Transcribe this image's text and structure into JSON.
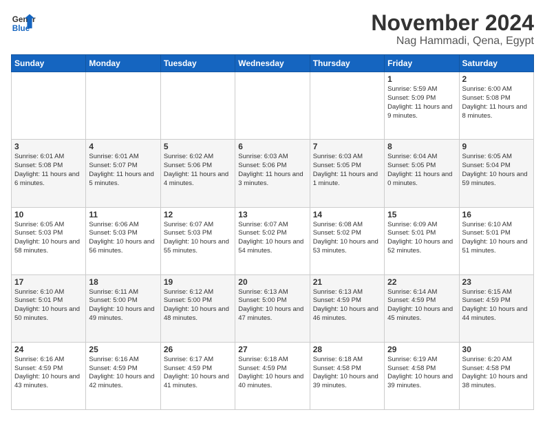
{
  "logo": {
    "line1": "General",
    "line2": "Blue"
  },
  "title": "November 2024",
  "subtitle": "Nag Hammadi, Qena, Egypt",
  "days_header": [
    "Sunday",
    "Monday",
    "Tuesday",
    "Wednesday",
    "Thursday",
    "Friday",
    "Saturday"
  ],
  "weeks": [
    [
      {
        "day": "",
        "info": ""
      },
      {
        "day": "",
        "info": ""
      },
      {
        "day": "",
        "info": ""
      },
      {
        "day": "",
        "info": ""
      },
      {
        "day": "",
        "info": ""
      },
      {
        "day": "1",
        "info": "Sunrise: 5:59 AM\nSunset: 5:09 PM\nDaylight: 11 hours\nand 9 minutes."
      },
      {
        "day": "2",
        "info": "Sunrise: 6:00 AM\nSunset: 5:08 PM\nDaylight: 11 hours\nand 8 minutes."
      }
    ],
    [
      {
        "day": "3",
        "info": "Sunrise: 6:01 AM\nSunset: 5:08 PM\nDaylight: 11 hours\nand 6 minutes."
      },
      {
        "day": "4",
        "info": "Sunrise: 6:01 AM\nSunset: 5:07 PM\nDaylight: 11 hours\nand 5 minutes."
      },
      {
        "day": "5",
        "info": "Sunrise: 6:02 AM\nSunset: 5:06 PM\nDaylight: 11 hours\nand 4 minutes."
      },
      {
        "day": "6",
        "info": "Sunrise: 6:03 AM\nSunset: 5:06 PM\nDaylight: 11 hours\nand 3 minutes."
      },
      {
        "day": "7",
        "info": "Sunrise: 6:03 AM\nSunset: 5:05 PM\nDaylight: 11 hours\nand 1 minute."
      },
      {
        "day": "8",
        "info": "Sunrise: 6:04 AM\nSunset: 5:05 PM\nDaylight: 11 hours\nand 0 minutes."
      },
      {
        "day": "9",
        "info": "Sunrise: 6:05 AM\nSunset: 5:04 PM\nDaylight: 10 hours\nand 59 minutes."
      }
    ],
    [
      {
        "day": "10",
        "info": "Sunrise: 6:05 AM\nSunset: 5:03 PM\nDaylight: 10 hours\nand 58 minutes."
      },
      {
        "day": "11",
        "info": "Sunrise: 6:06 AM\nSunset: 5:03 PM\nDaylight: 10 hours\nand 56 minutes."
      },
      {
        "day": "12",
        "info": "Sunrise: 6:07 AM\nSunset: 5:03 PM\nDaylight: 10 hours\nand 55 minutes."
      },
      {
        "day": "13",
        "info": "Sunrise: 6:07 AM\nSunset: 5:02 PM\nDaylight: 10 hours\nand 54 minutes."
      },
      {
        "day": "14",
        "info": "Sunrise: 6:08 AM\nSunset: 5:02 PM\nDaylight: 10 hours\nand 53 minutes."
      },
      {
        "day": "15",
        "info": "Sunrise: 6:09 AM\nSunset: 5:01 PM\nDaylight: 10 hours\nand 52 minutes."
      },
      {
        "day": "16",
        "info": "Sunrise: 6:10 AM\nSunset: 5:01 PM\nDaylight: 10 hours\nand 51 minutes."
      }
    ],
    [
      {
        "day": "17",
        "info": "Sunrise: 6:10 AM\nSunset: 5:01 PM\nDaylight: 10 hours\nand 50 minutes."
      },
      {
        "day": "18",
        "info": "Sunrise: 6:11 AM\nSunset: 5:00 PM\nDaylight: 10 hours\nand 49 minutes."
      },
      {
        "day": "19",
        "info": "Sunrise: 6:12 AM\nSunset: 5:00 PM\nDaylight: 10 hours\nand 48 minutes."
      },
      {
        "day": "20",
        "info": "Sunrise: 6:13 AM\nSunset: 5:00 PM\nDaylight: 10 hours\nand 47 minutes."
      },
      {
        "day": "21",
        "info": "Sunrise: 6:13 AM\nSunset: 4:59 PM\nDaylight: 10 hours\nand 46 minutes."
      },
      {
        "day": "22",
        "info": "Sunrise: 6:14 AM\nSunset: 4:59 PM\nDaylight: 10 hours\nand 45 minutes."
      },
      {
        "day": "23",
        "info": "Sunrise: 6:15 AM\nSunset: 4:59 PM\nDaylight: 10 hours\nand 44 minutes."
      }
    ],
    [
      {
        "day": "24",
        "info": "Sunrise: 6:16 AM\nSunset: 4:59 PM\nDaylight: 10 hours\nand 43 minutes."
      },
      {
        "day": "25",
        "info": "Sunrise: 6:16 AM\nSunset: 4:59 PM\nDaylight: 10 hours\nand 42 minutes."
      },
      {
        "day": "26",
        "info": "Sunrise: 6:17 AM\nSunset: 4:59 PM\nDaylight: 10 hours\nand 41 minutes."
      },
      {
        "day": "27",
        "info": "Sunrise: 6:18 AM\nSunset: 4:59 PM\nDaylight: 10 hours\nand 40 minutes."
      },
      {
        "day": "28",
        "info": "Sunrise: 6:18 AM\nSunset: 4:58 PM\nDaylight: 10 hours\nand 39 minutes."
      },
      {
        "day": "29",
        "info": "Sunrise: 6:19 AM\nSunset: 4:58 PM\nDaylight: 10 hours\nand 39 minutes."
      },
      {
        "day": "30",
        "info": "Sunrise: 6:20 AM\nSunset: 4:58 PM\nDaylight: 10 hours\nand 38 minutes."
      }
    ]
  ]
}
